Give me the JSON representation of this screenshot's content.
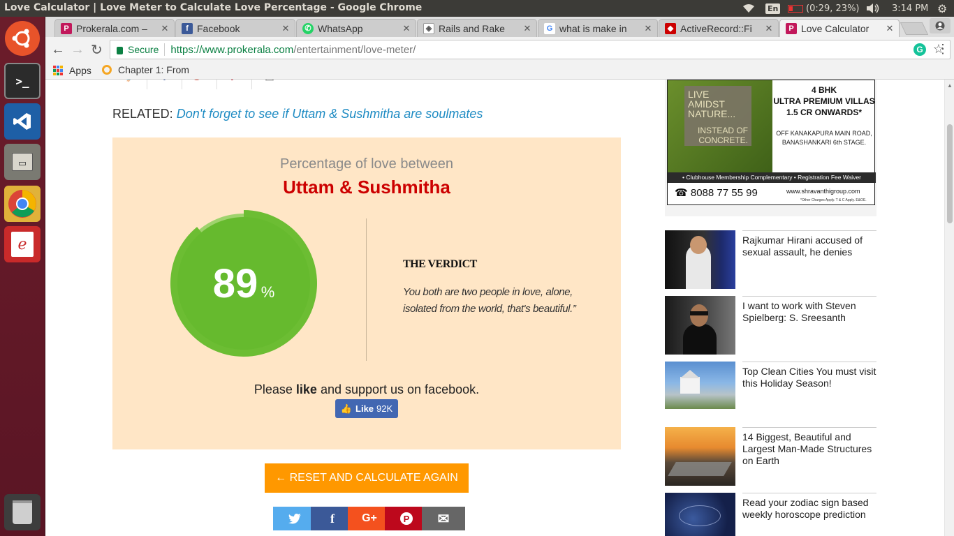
{
  "os_panel": {
    "window_title": "Love Calculator | Love Meter to Calculate Love Percentage - Google Chrome",
    "keyboard_lang": "En",
    "battery": "(0:29, 23%)",
    "clock": "3:14 PM"
  },
  "tabs": [
    {
      "label": "Prokerala.com –",
      "favicon": "P",
      "color": "#c2185b"
    },
    {
      "label": "Facebook",
      "favicon": "f",
      "color": "#3b5998"
    },
    {
      "label": "WhatsApp",
      "favicon": "✆",
      "color": "#25d366"
    },
    {
      "label": "Rails and Rake",
      "favicon": "◈",
      "color": "#555555"
    },
    {
      "label": "what is make in",
      "favicon": "G",
      "color": "#4285f4"
    },
    {
      "label": "ActiveRecord::Fi",
      "favicon": "◆",
      "color": "#cc0000"
    },
    {
      "label": "Love Calculator",
      "favicon": "P",
      "color": "#c2185b",
      "active": true
    }
  ],
  "toolbar": {
    "secure_label": "Secure",
    "url_host": "https://www.prokerala.com",
    "url_path": "/entertainment/love-meter/"
  },
  "bookmarks": {
    "apps_label": "Apps",
    "item1": "Chapter 1: From"
  },
  "related": {
    "prefix": "RELATED:",
    "link": "Don't forget to see if Uttam & Sushmitha are soulmates"
  },
  "result": {
    "heading": "Percentage of love between",
    "names": "Uttam & Sushmitha",
    "percent": "89",
    "percent_sign": "%",
    "percent_value": 89,
    "verdict_title": "THE VERDICT",
    "verdict_text": "You both are two people in love, alone, isolated from the world, that's beautiful.”",
    "support_pre": "Please ",
    "support_bold": "like",
    "support_post": " and support us on facebook.",
    "like_label": "Like",
    "like_count": "92K"
  },
  "reset_button": "← RESET AND CALCULATE AGAIN",
  "ad": {
    "tagline1": "LIVE AMIDST NATURE...",
    "tagline2": "INSTEAD OF CONCRETE.",
    "headline1": "4 BHK",
    "headline2": "ULTRA PREMIUM VILLAS",
    "headline3": "1.5 CR ONWARDS*",
    "address1": "OFF KANAKAPURA MAIN ROAD,",
    "address2": "BANASHANKARI 6th STAGE.",
    "strip": "• Clubhouse Membership Complementary  • Registration Fee Waiver",
    "phone": "8088 77 55 99",
    "website": "www.shravanthigroup.com",
    "fineprint": "*Other Charges Apply. T & C Apply. E&OE."
  },
  "news": [
    {
      "title": "Rajkumar Hirani accused of sexual assault, he denies"
    },
    {
      "title": "I want to work with Steven Spielberg: S. Sreesanth"
    },
    {
      "title": "Top Clean Cities You must visit this Holiday Season!"
    },
    {
      "title": "14 Biggest, Beautiful and Largest Man-Made Structures on Earth"
    },
    {
      "title": "Read your zodiac sign based weekly horoscope prediction"
    }
  ],
  "colors": {
    "result_bg": "#ffe6c6",
    "names_red": "#cc0000",
    "ring_green": "#6cbd33",
    "reset_orange": "#ff9800",
    "link_blue": "#1e8bc3"
  }
}
